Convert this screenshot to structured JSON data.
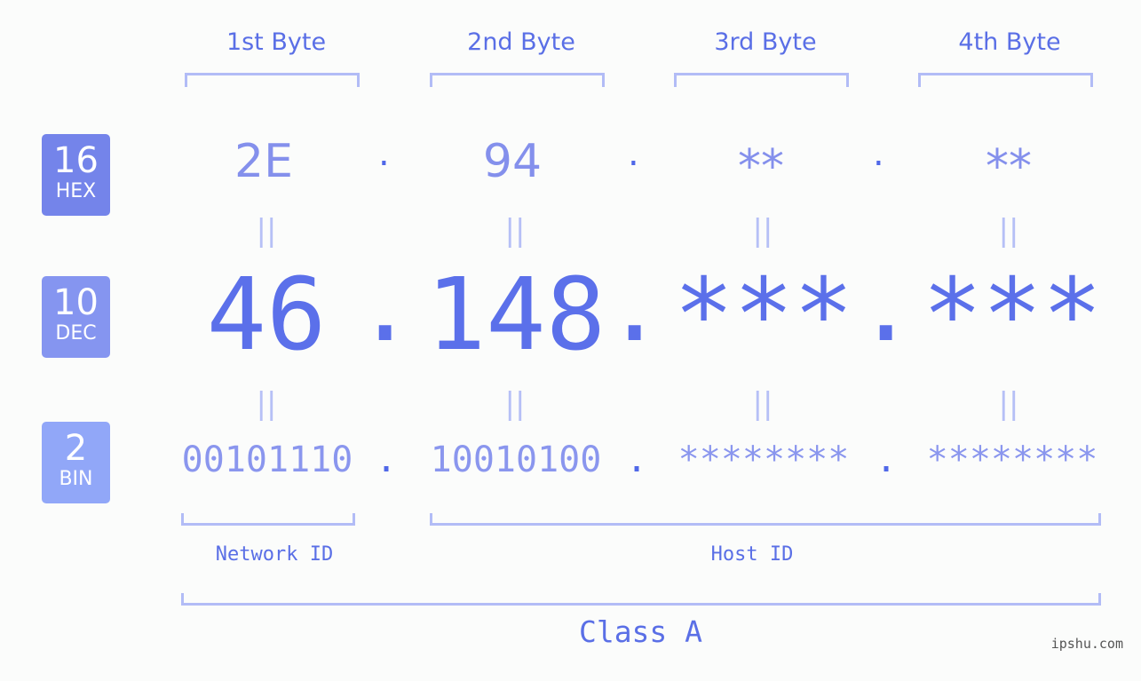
{
  "badges": [
    {
      "number": "16",
      "label": "HEX",
      "color": "#7484ea"
    },
    {
      "number": "10",
      "label": "DEC",
      "color": "#8595f0"
    },
    {
      "number": "2",
      "label": "BIN",
      "color": "#91a7f8"
    }
  ],
  "byte_headers": [
    "1st Byte",
    "2nd Byte",
    "3rd Byte",
    "4th Byte"
  ],
  "hex": [
    "2E",
    "94",
    "**",
    "**"
  ],
  "dec": [
    "46",
    "148",
    "***",
    "***"
  ],
  "bin": [
    "00101110",
    "10010100",
    "********",
    "********"
  ],
  "separator": ".",
  "equals": "||",
  "segments": {
    "network": "Network ID",
    "host": "Host ID"
  },
  "class_label": "Class A",
  "watermark": "ipshu.com",
  "colors": {
    "accent": "#5b70ea",
    "bracket": "#b2bcf6",
    "background": "#fbfcfb"
  }
}
